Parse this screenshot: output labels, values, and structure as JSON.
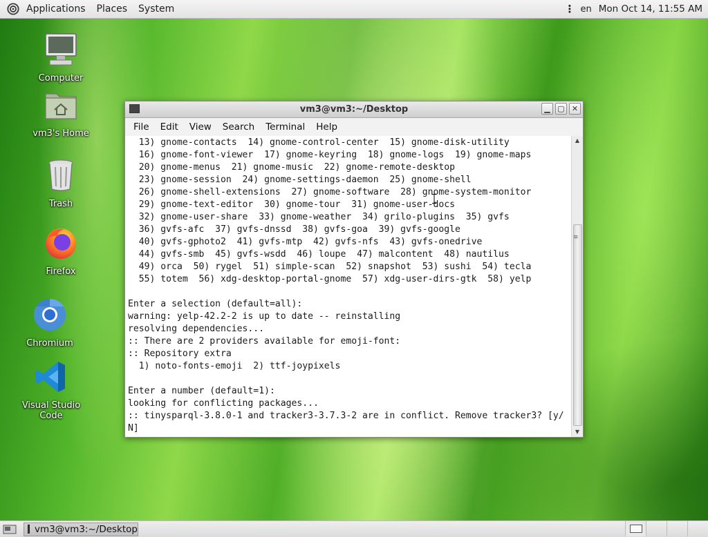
{
  "top_panel": {
    "menu": [
      "Applications",
      "Places",
      "System"
    ],
    "language": "en",
    "clock": "Mon Oct 14, 11:55 AM"
  },
  "desktop_icons": [
    {
      "label": "Computer"
    },
    {
      "label": "vm3's Home"
    },
    {
      "label": "Trash"
    },
    {
      "label": "Firefox"
    },
    {
      "label": "Chromium"
    },
    {
      "label": "Visual Studio Code"
    }
  ],
  "terminal": {
    "title": "vm3@vm3:~/Desktop",
    "menu": [
      "File",
      "Edit",
      "View",
      "Search",
      "Terminal",
      "Help"
    ],
    "lines": [
      "  13) gnome-contacts  14) gnome-control-center  15) gnome-disk-utility",
      "  16) gnome-font-viewer  17) gnome-keyring  18) gnome-logs  19) gnome-maps",
      "  20) gnome-menus  21) gnome-music  22) gnome-remote-desktop",
      "  23) gnome-session  24) gnome-settings-daemon  25) gnome-shell",
      "  26) gnome-shell-extensions  27) gnome-software  28) gnome-system-monitor",
      "  29) gnome-text-editor  30) gnome-tour  31) gnome-user-docs",
      "  32) gnome-user-share  33) gnome-weather  34) grilo-plugins  35) gvfs",
      "  36) gvfs-afc  37) gvfs-dnssd  38) gvfs-goa  39) gvfs-google",
      "  40) gvfs-gphoto2  41) gvfs-mtp  42) gvfs-nfs  43) gvfs-onedrive",
      "  44) gvfs-smb  45) gvfs-wsdd  46) loupe  47) malcontent  48) nautilus",
      "  49) orca  50) rygel  51) simple-scan  52) snapshot  53) sushi  54) tecla",
      "  55) totem  56) xdg-desktop-portal-gnome  57) xdg-user-dirs-gtk  58) yelp",
      "",
      "Enter a selection (default=all):",
      "warning: yelp-42.2-2 is up to date -- reinstalling",
      "resolving dependencies...",
      ":: There are 2 providers available for emoji-font:",
      ":: Repository extra",
      "  1) noto-fonts-emoji  2) ttf-joypixels",
      "",
      "Enter a number (default=1):",
      "looking for conflicting packages...",
      ":: tinysparql-3.8.0-1 and tracker3-3.7.3-2 are in conflict. Remove tracker3? [y/",
      "N]"
    ]
  },
  "taskbar": {
    "task_label": "vm3@vm3:~/Desktop"
  }
}
